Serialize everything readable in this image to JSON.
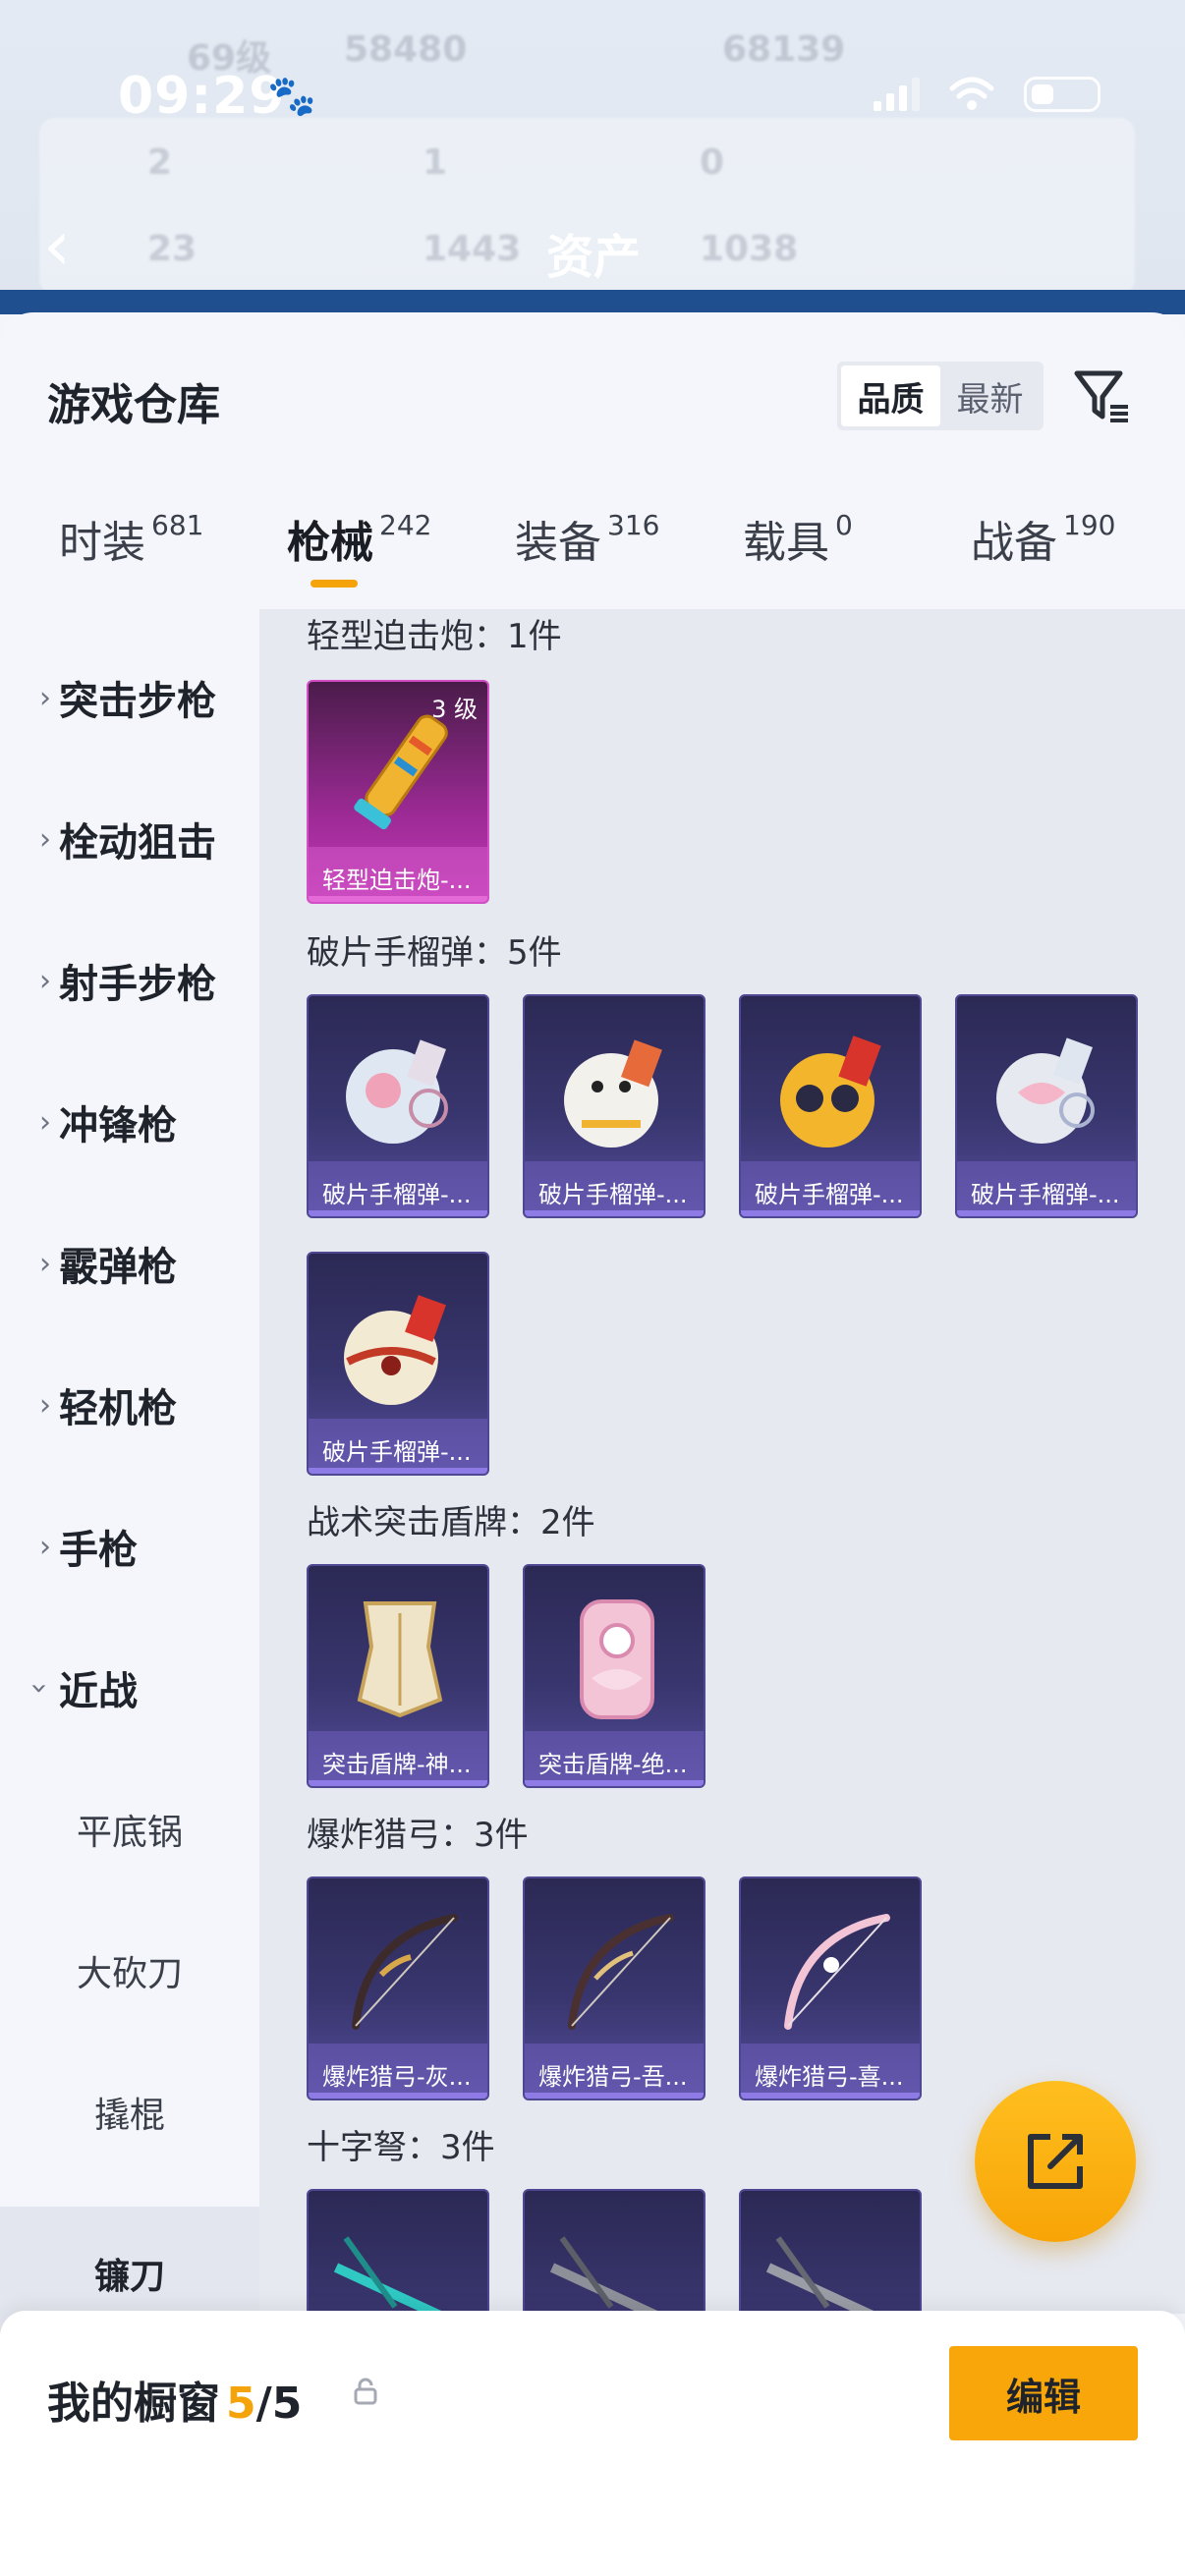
{
  "status_bar": {
    "time": "09:29"
  },
  "header": {
    "title": "资产"
  },
  "background_ghost": {
    "level": "69级",
    "score_a": "58480",
    "score_b": "68139",
    "n1": "2",
    "n2": "1",
    "n3": "0",
    "n4": "23",
    "n5": "1443",
    "n6": "1038"
  },
  "sheet": {
    "title": "游戏仓库",
    "sort_options": [
      "品质",
      "最新"
    ],
    "sort_active": "品质"
  },
  "tabs": [
    {
      "label": "时装",
      "count": "681"
    },
    {
      "label": "枪械",
      "count": "242"
    },
    {
      "label": "装备",
      "count": "316"
    },
    {
      "label": "载具",
      "count": "0"
    },
    {
      "label": "战备",
      "count": "190"
    }
  ],
  "sidebar": {
    "categories": [
      "突击步枪",
      "栓动狙击",
      "射手步枪",
      "冲锋枪",
      "霰弹枪",
      "轻机枪",
      "手枪",
      "近战"
    ],
    "expanded": "近战",
    "subitems": [
      "平底锅",
      "大砍刀",
      "撬棍",
      "镰刀"
    ],
    "active_sub": "镰刀"
  },
  "sections": [
    {
      "heading": "轻型迫击炮：1件",
      "items": [
        {
          "caption": "轻型迫击炮-...",
          "level": "3 级"
        }
      ]
    },
    {
      "heading": "破片手榴弹：5件",
      "items": [
        {
          "caption": "破片手榴弹-..."
        },
        {
          "caption": "破片手榴弹-..."
        },
        {
          "caption": "破片手榴弹-..."
        },
        {
          "caption": "破片手榴弹-..."
        },
        {
          "caption": "破片手榴弹-..."
        }
      ]
    },
    {
      "heading": "战术突击盾牌：2件",
      "items": [
        {
          "caption": "突击盾牌-神..."
        },
        {
          "caption": "突击盾牌-绝..."
        }
      ]
    },
    {
      "heading": "爆炸猎弓：3件",
      "items": [
        {
          "caption": "爆炸猎弓-灰..."
        },
        {
          "caption": "爆炸猎弓-吾..."
        },
        {
          "caption": "爆炸猎弓-喜..."
        }
      ]
    },
    {
      "heading": "十字弩：3件",
      "items": [
        {
          "caption": ""
        },
        {
          "caption": ""
        },
        {
          "caption": ""
        }
      ]
    }
  ],
  "footer": {
    "title": "我的橱窗",
    "current": "5",
    "slash": "/",
    "max": "5",
    "edit_label": "编辑"
  },
  "colors": {
    "accent": "#f5a30a",
    "card_purple": "#39366f",
    "card_pink": "#c53ab8"
  }
}
